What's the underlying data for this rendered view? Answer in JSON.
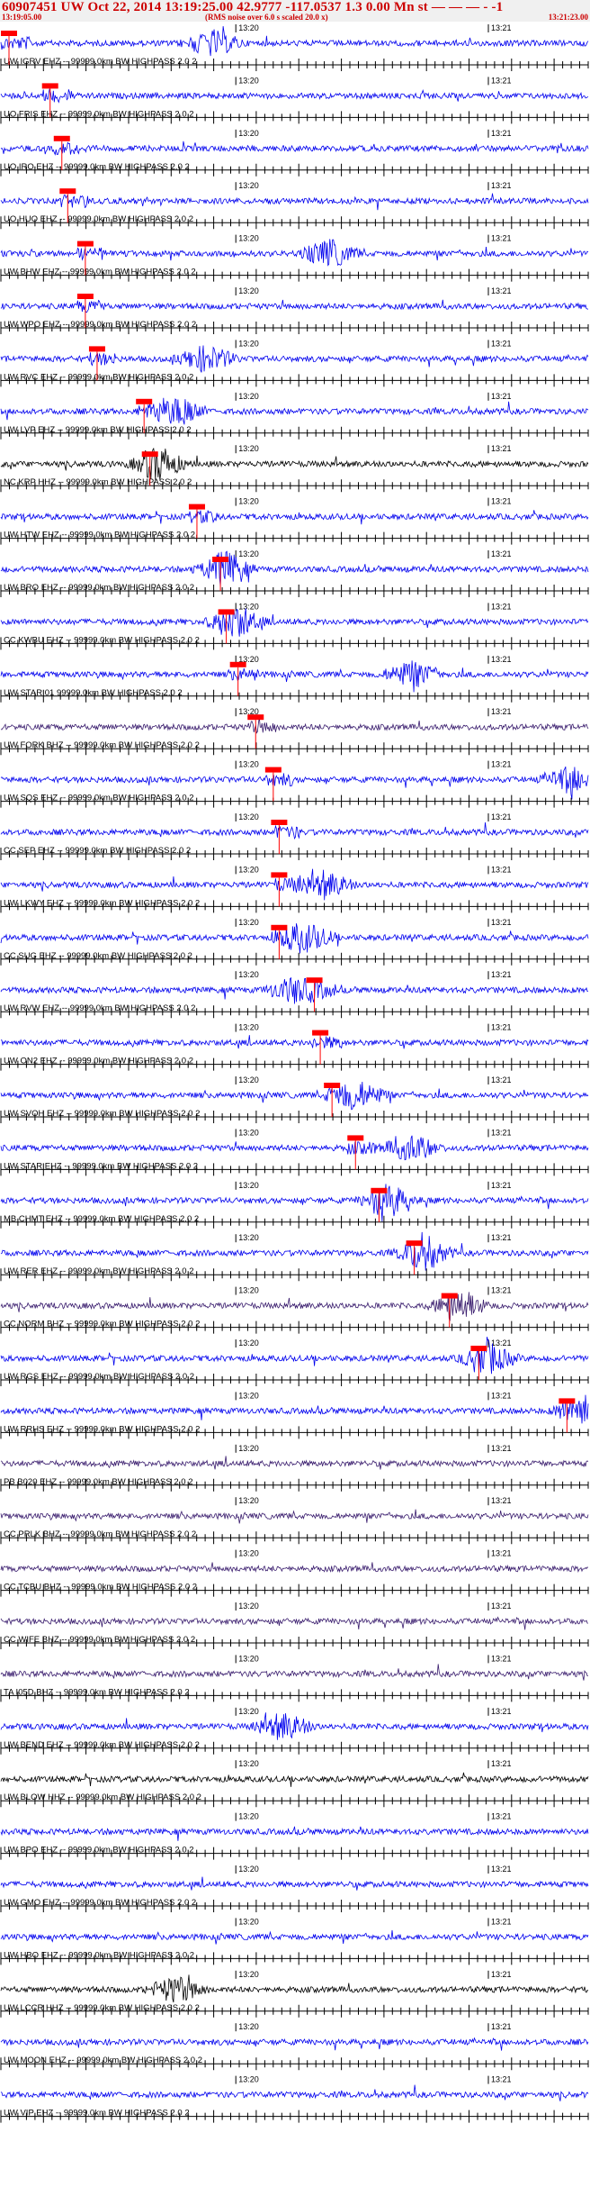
{
  "header": {
    "title": "60907451 UW Oct 22, 2014 13:19:25.00   42.9777 -117.0537  1.3 0.00 Mn st — — — -   -1",
    "start_time": "13:19:05.00",
    "note": "(RMS noise over 6.0 s scaled 20.0 x)",
    "end_time": "13:21:23.00"
  },
  "time_marks": {
    "first": "13:20",
    "second": "13:21"
  },
  "colors": {
    "trace_blue": "#0000ee",
    "trace_black": "#000000",
    "trace_purple": "#3a1d6e",
    "pick_red": "#ff0000",
    "axis": "#000000",
    "header_text": "#cc0000"
  },
  "traces": [
    {
      "label": "UW IGRV EHZ -- 99999.0km BW  HIGHPASS  2.0  2",
      "color": "blue",
      "pick": 0.0,
      "burst": 0.36
    },
    {
      "label": "UO FRIS EHZ -- 99999.0km BW  HIGHPASS  2.0  2",
      "color": "blue",
      "pick": 0.07,
      "burst": 0
    },
    {
      "label": "UO IRO EHZ -- 99999.0km BW  HIGHPASS  2.0  2",
      "color": "blue",
      "pick": 0.09,
      "burst": 0
    },
    {
      "label": "UO HUO EHZ -- 99999.0km BW  HIGHPASS  2.0  2",
      "color": "blue",
      "pick": 0.1,
      "burst": 0
    },
    {
      "label": "UW BHW EHZ -- 99999.0km BW  HIGHPASS  2.0  2",
      "color": "blue",
      "pick": 0.13,
      "burst": 0.56
    },
    {
      "label": "UW WPO EHZ -- 99999.0km BW  HIGHPASS  2.0  2",
      "color": "blue",
      "pick": 0.13,
      "burst": 0
    },
    {
      "label": "UW RVC EHZ -- 99999.0km BW  HIGHPASS  2.0  2",
      "color": "blue",
      "pick": 0.15,
      "burst": 0.35
    },
    {
      "label": "UW LVP EHZ -- 99999.0km BW  HIGHPASS  2.0  2",
      "color": "blue",
      "pick": 0.23,
      "burst": 0.3
    },
    {
      "label": "NC KRP HHZ -- 99999.0km BW  HIGHPASS  2.0  2",
      "color": "black",
      "pick": 0.24,
      "burst": 0.27
    },
    {
      "label": "UW HTW EHZ -- 99999.0km BW  HIGHPASS  2.0  2",
      "color": "blue",
      "pick": 0.32,
      "burst": 0
    },
    {
      "label": "UW BRO EHZ -- 99999.0km BW  HIGHPASS  2.0  2",
      "color": "blue",
      "pick": 0.36,
      "burst": 0.38
    },
    {
      "label": "CC KWBU EHZ -- 99999.0km BW  HIGHPASS  2.0  2",
      "color": "blue",
      "pick": 0.37,
      "burst": 0.4
    },
    {
      "label": "UW STAR 01 99999.0km BW  HIGHPASS  2.0  2",
      "color": "blue",
      "pick": 0.39,
      "burst": 0.7
    },
    {
      "label": "UW FORK BHZ -- 99999.0km BW  HIGHPASS  2.0  2",
      "color": "purple",
      "pick": 0.42,
      "burst": 0
    },
    {
      "label": "UW SQS EHZ -- 99999.0km BW  HIGHPASS  2.0  2",
      "color": "blue",
      "pick": 0.45,
      "burst": 0.97
    },
    {
      "label": "CC SEP EHZ -- 99999.0km BW  HIGHPASS  2.0  2",
      "color": "blue",
      "pick": 0.46,
      "burst": 0
    },
    {
      "label": "UW LKWY EHZ -- 99999.0km BW  HIGHPASS  2.0  2",
      "color": "blue",
      "pick": 0.46,
      "burst": 0.55
    },
    {
      "label": "CC SUG EHZ -- 99999.0km BW  HIGHPASS  2.0  2",
      "color": "blue",
      "pick": 0.46,
      "burst": 0.52
    },
    {
      "label": "UW RVW EHZ -- 99999.0km BW  HIGHPASS  2.0  2",
      "color": "blue",
      "pick": 0.52,
      "burst": 0.5
    },
    {
      "label": "UW ON2 EHZ -- 99999.0km BW  HIGHPASS  2.0  2",
      "color": "blue",
      "pick": 0.53,
      "burst": 0
    },
    {
      "label": "UW SVOH EHZ -- 99999.0km BW  HIGHPASS  2.0  2",
      "color": "blue",
      "pick": 0.55,
      "burst": 0.61
    },
    {
      "label": "UW STAR EHZ -- 99999.0km BW  HIGHPASS  2.0  2",
      "color": "blue",
      "pick": 0.59,
      "burst": 0.7
    },
    {
      "label": "MB CHMT EHZ -- 99999.0km BW  HIGHPASS  2.0  2",
      "color": "blue",
      "pick": 0.63,
      "burst": 0.66
    },
    {
      "label": "UW RER EHZ -- 99999.0km BW  HIGHPASS  2.0  2",
      "color": "blue",
      "pick": 0.69,
      "burst": 0.72
    },
    {
      "label": "CC NORM BHZ -- 99999.0km BW  HIGHPASS  2.0  2",
      "color": "purple",
      "pick": 0.75,
      "burst": 0.78
    },
    {
      "label": "UW RGS EHZ -- 99999.0km BW  HIGHPASS  2.0  2",
      "color": "blue",
      "pick": 0.8,
      "burst": 0.83
    },
    {
      "label": "UW RRHS EHZ -- 99999.0km BW  HIGHPASS  2.0  2",
      "color": "blue",
      "pick": 0.95,
      "burst": 0.99
    },
    {
      "label": "PB B020 EHZ -- 99999.0km BW  HIGHPASS  2.0  2",
      "color": "purple",
      "pick": null,
      "burst": 0
    },
    {
      "label": "CC PRLK BHZ -- 99999.0km BW  HIGHPASS  2.0  2",
      "color": "purple",
      "pick": null,
      "burst": 0
    },
    {
      "label": "CC TCBU BHZ -- 99999.0km BW  HIGHPASS  2.0  2",
      "color": "purple",
      "pick": null,
      "burst": 0
    },
    {
      "label": "CC WIFE BHZ -- 99999.0km BW  HIGHPASS  2.0  2",
      "color": "purple",
      "pick": null,
      "burst": 0
    },
    {
      "label": "TA I05D BHZ -- 99999.0km BW  HIGHPASS  2.0  2",
      "color": "purple",
      "pick": null,
      "burst": 0
    },
    {
      "label": "UW BEND EHZ -- 99999.0km BW  HIGHPASS  2.0  2",
      "color": "blue",
      "pick": null,
      "burst": 0.48
    },
    {
      "label": "UW BLOW HHZ -- 99999.0km BW  HIGHPASS  2.0  2",
      "color": "black",
      "pick": null,
      "burst": 0
    },
    {
      "label": "UW BPO EHZ -- 99999.0km BW  HIGHPASS  2.0  2",
      "color": "blue",
      "pick": null,
      "burst": 0
    },
    {
      "label": "UW GMO EHZ -- 99999.0km BW  HIGHPASS  2.0  2",
      "color": "blue",
      "pick": null,
      "burst": 0
    },
    {
      "label": "UW HBO EHZ -- 99999.0km BW  HIGHPASS  2.0  2",
      "color": "blue",
      "pick": null,
      "burst": 0
    },
    {
      "label": "UW LCCR HHZ -- 99999.0km BW  HIGHPASS  2.0  2",
      "color": "black",
      "pick": null,
      "burst": 0.3
    },
    {
      "label": "UW MOON EHZ -- 99999.0km BW  HIGHPASS  2.0  2",
      "color": "blue",
      "pick": null,
      "burst": 0
    },
    {
      "label": "UW VIP EHZ -- 99999.0km BW  HIGHPASS  2.0  2",
      "color": "blue",
      "pick": null,
      "burst": 0
    }
  ]
}
